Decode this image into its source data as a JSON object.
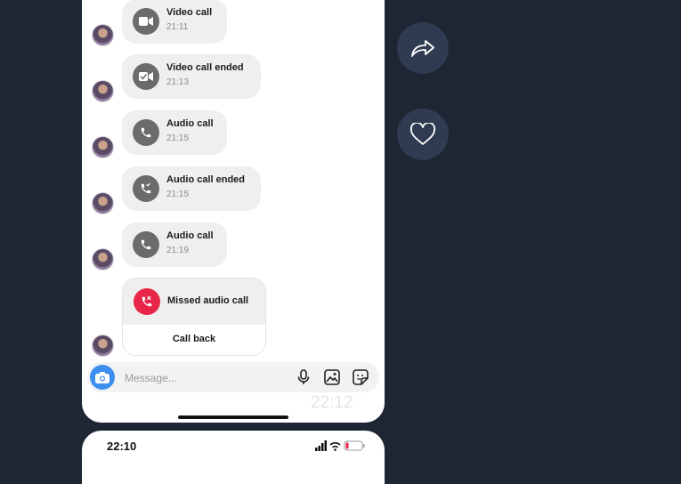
{
  "chat": {
    "calls": [
      {
        "title": "Video call",
        "time": "21:11",
        "icon": "video-camera-icon"
      },
      {
        "title": "Video call ended",
        "time": "21:13",
        "icon": "video-ended-icon"
      },
      {
        "title": "Audio call",
        "time": "21:15",
        "icon": "phone-icon"
      },
      {
        "title": "Audio call ended",
        "time": "21:15",
        "icon": "phone-ended-icon"
      },
      {
        "title": "Audio call",
        "time": "21:19",
        "icon": "phone-icon"
      }
    ],
    "missed": {
      "title": "Missed audio call",
      "action": "Call back",
      "icon": "missed-call-icon"
    }
  },
  "composer": {
    "placeholder": "Message..."
  },
  "overlay_time": "22:12",
  "next_screen": {
    "status_time": "22:10"
  },
  "side_actions": {
    "share_icon": "share-arrow-icon",
    "like_icon": "heart-icon"
  },
  "colors": {
    "background": "#1e2533",
    "missed_red": "#e8264a",
    "camera_blue": "#3c8ff0",
    "side_button": "#2e3b50"
  }
}
